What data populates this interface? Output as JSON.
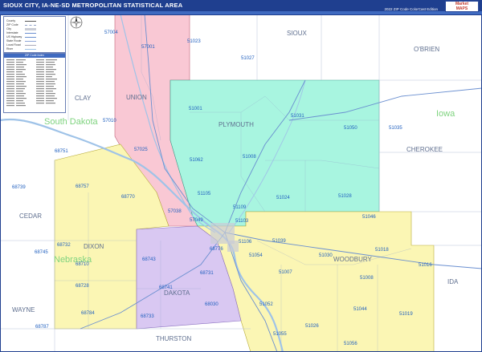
{
  "title": "SIOUX CITY, IA-NE-SD METROPOLITAN STATISTICAL AREA",
  "edition": "2022 ZIP Code ColorCast Edition",
  "logo": {
    "line1": "Market",
    "line2": "MAPS"
  },
  "colors": {
    "title_bar": "#1f3f8f",
    "union_county": "#f9c8d4",
    "plymouth_county": "#a8f5e0",
    "woodbury_county": "#fbf6b4",
    "dixon_county": "#fbf6b4",
    "dakota_county": "#d9c8f2",
    "river": "#9fc3e8",
    "highway": "#6a8fd0",
    "zip_label": "#1f5fbf",
    "county_label": "#5f6f8f",
    "state_label": "#7fd37f"
  },
  "legend": {
    "items": [
      {
        "label": "County",
        "symbol": "county-line-icon"
      },
      {
        "label": "ZIP Code",
        "symbol": "zip-line-icon"
      },
      {
        "label": "City",
        "symbol": "city-line-icon"
      },
      {
        "label": "Interstate",
        "symbol": "interstate-line-icon"
      },
      {
        "label": "US Highway",
        "symbol": "us-highway-line-icon"
      },
      {
        "label": "State Route",
        "symbol": "state-route-line-icon"
      },
      {
        "label": "Local Road",
        "symbol": "local-road-line-icon"
      },
      {
        "label": "River",
        "symbol": "river-line-icon"
      }
    ]
  },
  "zip_table": {
    "title": "ZIP Code Index"
  },
  "states": [
    {
      "name": "South Dakota"
    },
    {
      "name": "Nebraska"
    },
    {
      "name": "Iowa"
    }
  ],
  "counties": [
    {
      "name": "SIOUX"
    },
    {
      "name": "O'BRIEN"
    },
    {
      "name": "CLAY"
    },
    {
      "name": "UNION"
    },
    {
      "name": "PLYMOUTH"
    },
    {
      "name": "CHEROKEE"
    },
    {
      "name": "CEDAR"
    },
    {
      "name": "DIXON"
    },
    {
      "name": "DAKOTA"
    },
    {
      "name": "WOODBURY"
    },
    {
      "name": "IDA"
    },
    {
      "name": "WAYNE"
    },
    {
      "name": "THURSTON"
    }
  ],
  "zips": [
    "57004",
    "57001",
    "51023",
    "51027",
    "57010",
    "51001",
    "51031",
    "51050",
    "51035",
    "57025",
    "68751",
    "51062",
    "51008",
    "68757",
    "68739",
    "68770",
    "51105",
    "51024",
    "51028",
    "57038",
    "51109",
    "51046",
    "57049",
    "51103",
    "51039",
    "68732",
    "51106",
    "68745",
    "68776",
    "51054",
    "51030",
    "51018",
    "68743",
    "68731",
    "51007",
    "68710",
    "68728",
    "68741",
    "51016",
    "68030",
    "51008",
    "68784",
    "51052",
    "51044",
    "68733",
    "51019",
    "68787",
    "51055",
    "51026",
    "51056"
  ]
}
